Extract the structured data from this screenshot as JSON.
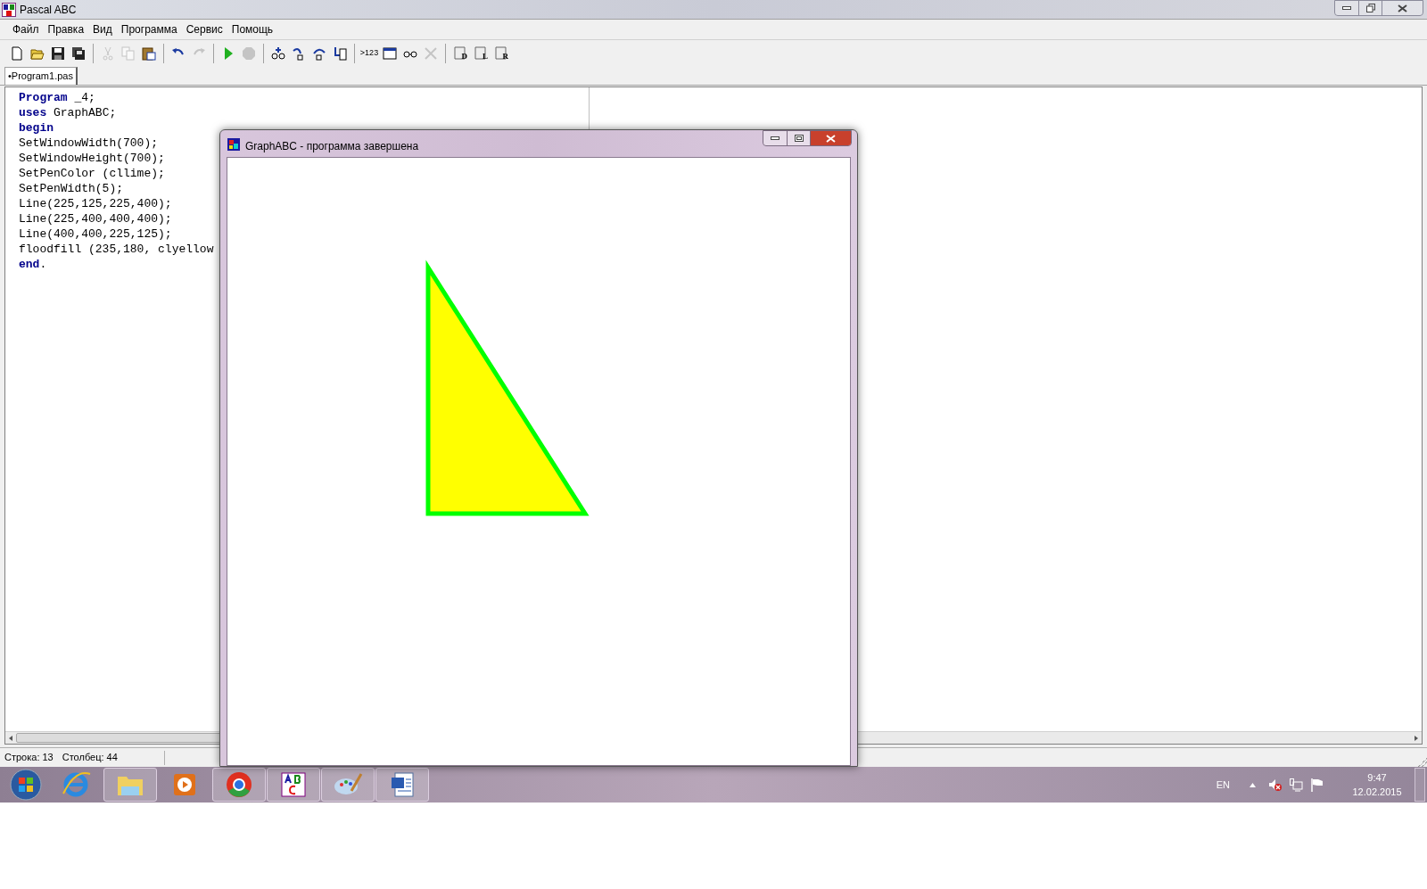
{
  "window": {
    "title": "Pascal ABC"
  },
  "menu": [
    {
      "label": "Файл"
    },
    {
      "label": "Правка"
    },
    {
      "label": "Вид"
    },
    {
      "label": "Программа"
    },
    {
      "label": "Сервис"
    },
    {
      "label": "Помощь"
    }
  ],
  "toolbar": [
    [
      {
        "disabled": false
      },
      {
        "disabled": false
      },
      {
        "disabled": false
      },
      {
        "disabled": false
      }
    ],
    [
      {
        "disabled": true
      },
      {
        "disabled": true
      },
      {
        "disabled": false
      }
    ],
    [
      {
        "disabled": false
      },
      {
        "disabled": true
      }
    ],
    [
      {
        "disabled": false
      },
      {
        "disabled": true
      }
    ],
    [
      {
        "disabled": false
      },
      {
        "disabled": false
      },
      {
        "disabled": false
      },
      {
        "disabled": false
      }
    ],
    [
      {
        "disabled": false,
        "label": ">123"
      },
      {
        "disabled": false
      },
      {
        "disabled": false
      },
      {
        "disabled": true
      }
    ],
    [
      {
        "disabled": false,
        "label": "D"
      },
      {
        "disabled": false,
        "label": "L"
      },
      {
        "disabled": false,
        "label": "R"
      }
    ]
  ],
  "tabs": [
    {
      "label": "•Program1.pas",
      "selected": true
    }
  ],
  "editor": {
    "lines": [
      "**Program** _4;",
      "**uses** GraphABC;",
      "**begin**",
      "SetWindowWidth(700);",
      "SetWindowHeight(700);",
      "SetPenColor (cllime);",
      "SetPenWidth(5);",
      "Line(225,125,225,400);",
      "Line(225,400,400,400);",
      "Line(400,400,225,125);",
      "floodfill (235,180, clyellow",
      "**end**."
    ]
  },
  "status_bar": {
    "row": "Строка: 13",
    "column": "Столбец: 44"
  },
  "graph_window": {
    "title": "GraphABC - программа завершена"
  },
  "taskbar": {
    "apps": [
      {
        "running": false
      },
      {
        "running": false
      },
      {
        "running": true
      },
      {
        "running": false
      },
      {
        "running": true
      },
      {
        "running": true
      },
      {
        "running": true
      },
      {
        "running": true
      }
    ],
    "language": "EN",
    "time": "9:47",
    "date": "12.02.2015"
  }
}
